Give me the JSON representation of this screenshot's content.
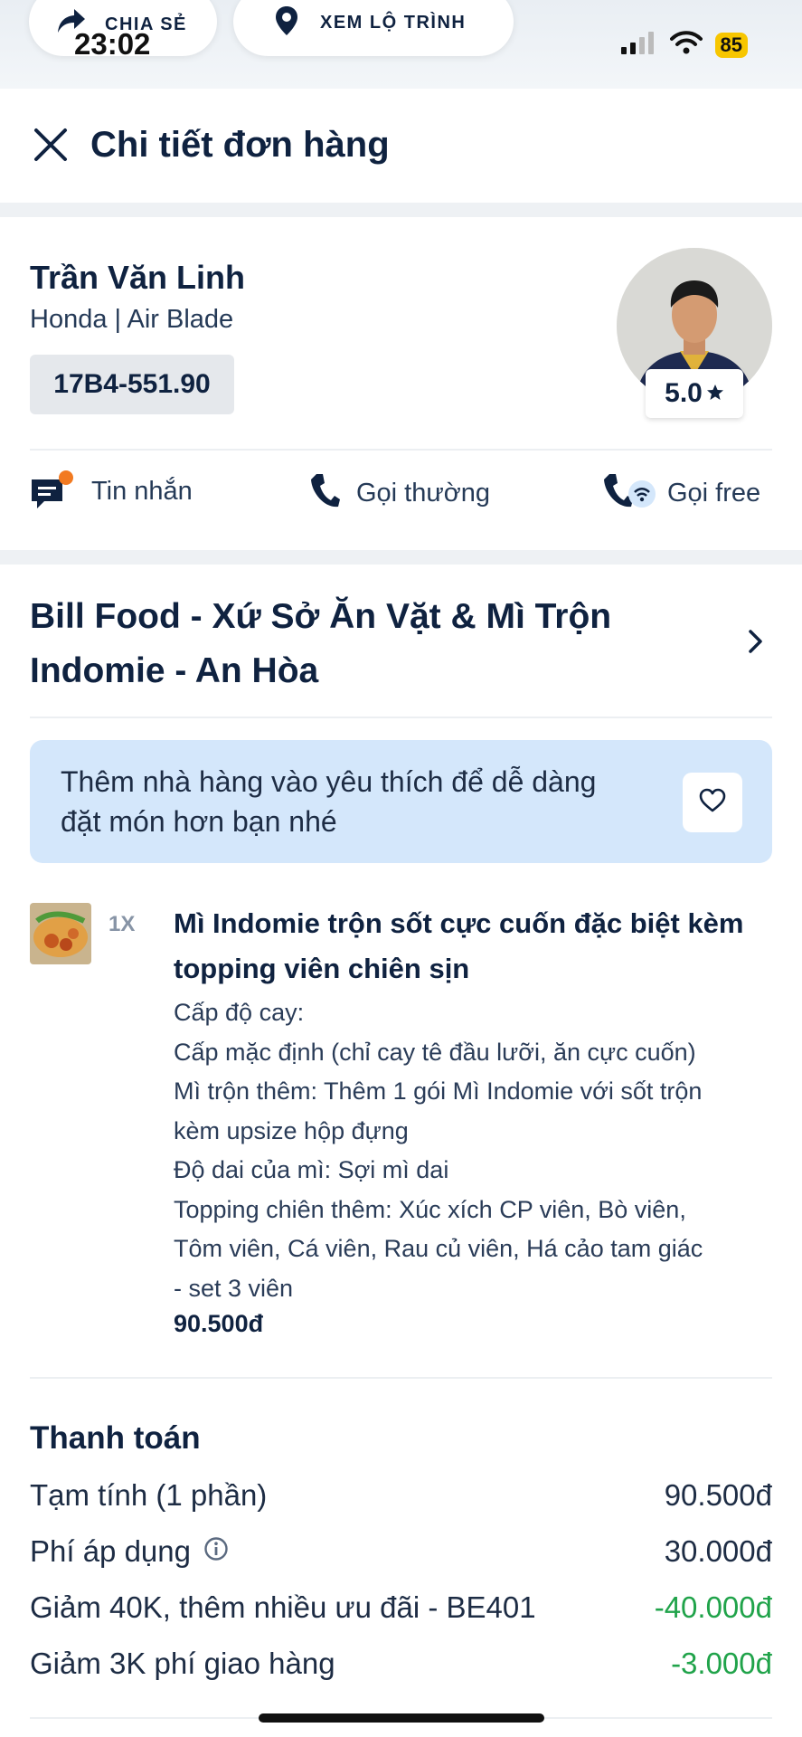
{
  "status_bar": {
    "time": "23:02",
    "battery": "85"
  },
  "top_actions": {
    "share_label": "CHIA SẺ",
    "route_label": "XEM LỘ TRÌNH"
  },
  "header": {
    "title": "Chi tiết đơn hàng"
  },
  "driver": {
    "name": "Trần Văn Linh",
    "vehicle": "Honda | Air Blade",
    "plate": "17B4-551.90",
    "rating": "5.0"
  },
  "contact_actions": {
    "message_label": "Tin nhắn",
    "call_label": "Gọi thường",
    "free_call_label": "Gọi free"
  },
  "restaurant": {
    "name": "Bill Food - Xứ Sở Ăn Vặt & Mì Trộn Indomie - An Hòa"
  },
  "favorite_banner": {
    "text": "Thêm nhà hàng vào yêu thích để dễ dàng đặt món hơn bạn nhé"
  },
  "order_item": {
    "quantity": "1X",
    "name": "Mì Indomie trộn sốt cực cuốn đặc biệt kèm topping viên chiên sịn",
    "options": [
      "Cấp độ cay:",
      "Cấp mặc định (chỉ cay tê đầu lưỡi, ăn cực cuốn)",
      "Mì trộn thêm: Thêm 1 gói Mì Indomie với sốt trộn",
      "kèm upsize hộp đựng",
      "Độ dai của mì: Sợi mì dai",
      "Topping chiên thêm: Xúc xích CP viên, Bò viên,",
      "Tôm viên, Cá viên, Rau củ viên, Há cảo tam giác",
      "- set 3 viên"
    ],
    "price": "90.500đ"
  },
  "payment": {
    "title": "Thanh toán",
    "rows": [
      {
        "label": "Tạm tính (1 phần)",
        "value": "90.500đ"
      },
      {
        "label": "Phí áp dụng",
        "value": "30.000đ"
      },
      {
        "label": "Giảm 40K, thêm nhiều ưu đãi - BE401",
        "value": "-40.000đ"
      },
      {
        "label": "Giảm 3K phí giao hàng",
        "value": "-3.000đ"
      }
    ]
  },
  "colors": {
    "accent_dark": "#0f2240",
    "discount_green": "#20a34a",
    "banner_blue": "#d4e7fb",
    "notify_orange": "#f27a21"
  }
}
